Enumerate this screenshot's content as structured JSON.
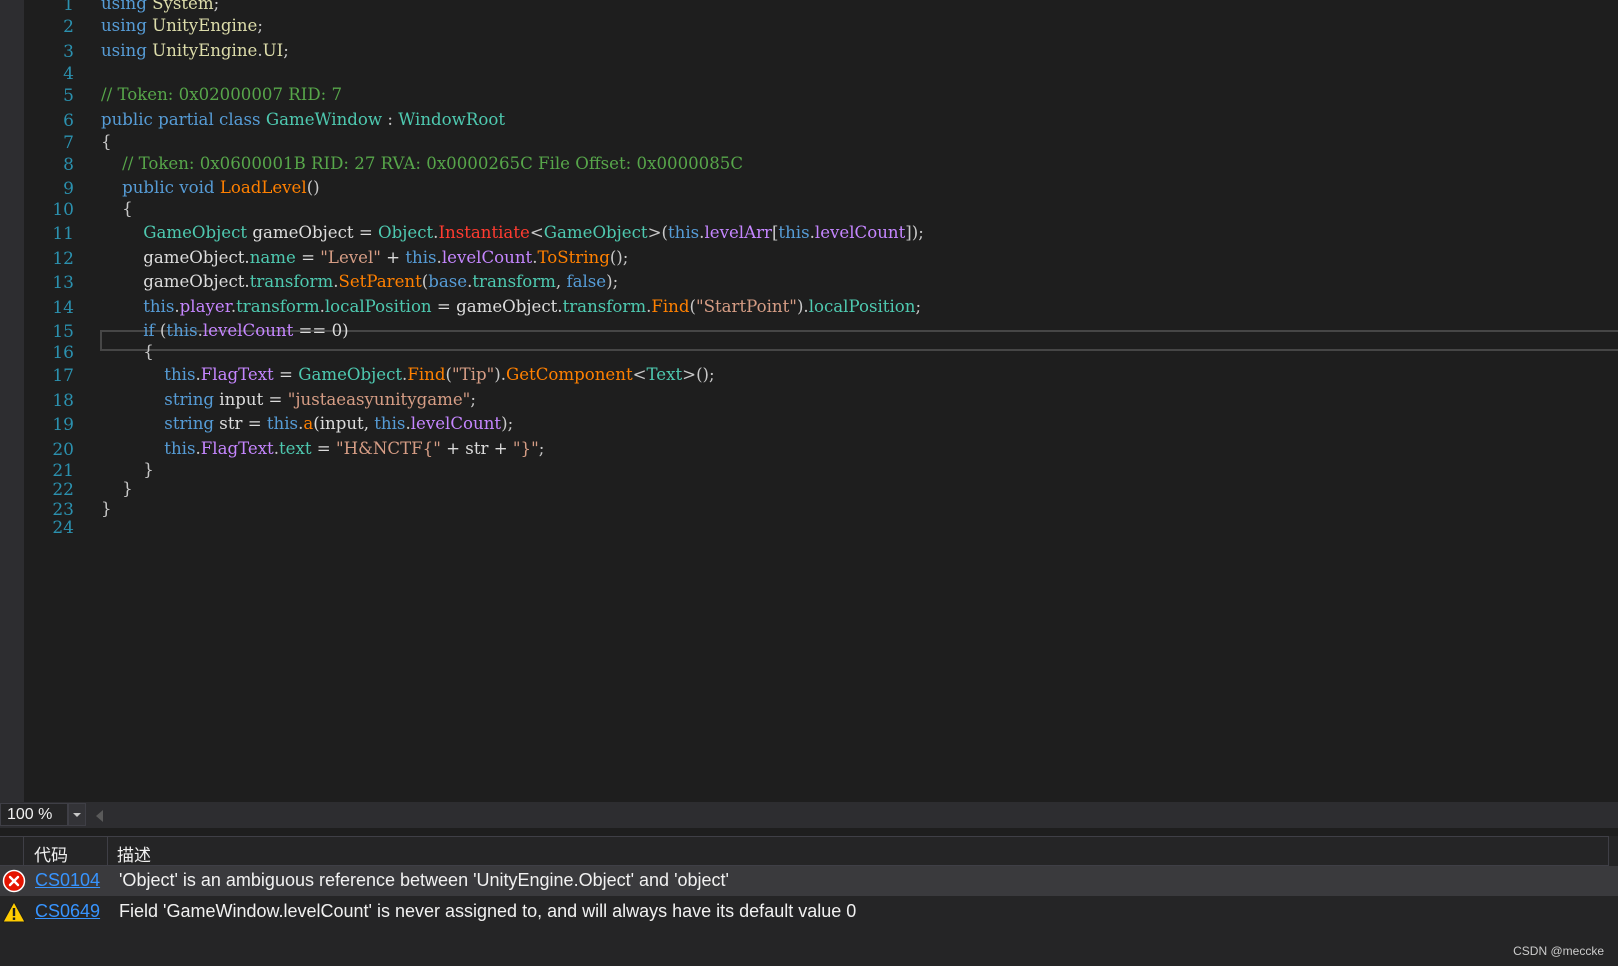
{
  "editor": {
    "line_numbers": [
      "1",
      "2",
      "3",
      "4",
      "5",
      "6",
      "7",
      "8",
      "9",
      "10",
      "11",
      "12",
      "13",
      "14",
      "15",
      "16",
      "17",
      "18",
      "19",
      "20",
      "21",
      "22",
      "23",
      "24"
    ],
    "colors": {
      "keyword": "#569cd6",
      "type": "#4ec9b0",
      "comment": "#57a64a",
      "string": "#d69d85",
      "method": "#ff8000",
      "error_token": "#ff3b30",
      "field": "#c586ff",
      "line_number": "#2b91af"
    },
    "lines": [
      {
        "tokens": [
          [
            "using",
            "k"
          ],
          [
            " ",
            "pl"
          ],
          [
            "System",
            "y"
          ],
          [
            ";",
            "p"
          ]
        ]
      },
      {
        "tokens": [
          [
            "using",
            "k"
          ],
          [
            " ",
            "pl"
          ],
          [
            "UnityEngine",
            "y"
          ],
          [
            ";",
            "p"
          ]
        ]
      },
      {
        "tokens": [
          [
            "using",
            "k"
          ],
          [
            " ",
            "pl"
          ],
          [
            "UnityEngine",
            "y"
          ],
          [
            ".",
            "p"
          ],
          [
            "UI",
            "y"
          ],
          [
            ";",
            "p"
          ]
        ]
      },
      {
        "tokens": []
      },
      {
        "tokens": [
          [
            "// Token: 0x02000007 RID: 7",
            "c"
          ]
        ]
      },
      {
        "tokens": [
          [
            "public",
            "k"
          ],
          [
            " ",
            "pl"
          ],
          [
            "partial",
            "k"
          ],
          [
            " ",
            "pl"
          ],
          [
            "class",
            "k"
          ],
          [
            " ",
            "pl"
          ],
          [
            "GameWindow",
            "t"
          ],
          [
            " : ",
            "p"
          ],
          [
            "WindowRoot",
            "t"
          ]
        ]
      },
      {
        "tokens": [
          [
            "{",
            "p"
          ]
        ]
      },
      {
        "tokens": [
          [
            "    ",
            "pl"
          ],
          [
            "// Token: 0x0600001B RID: 27 RVA: 0x0000265C File Offset: 0x0000085C",
            "c"
          ]
        ]
      },
      {
        "tokens": [
          [
            "    ",
            "pl"
          ],
          [
            "public",
            "k"
          ],
          [
            " ",
            "pl"
          ],
          [
            "void",
            "k"
          ],
          [
            " ",
            "pl"
          ],
          [
            "LoadLevel",
            "m"
          ],
          [
            "()",
            "p"
          ]
        ]
      },
      {
        "tokens": [
          [
            "    {",
            "p"
          ]
        ]
      },
      {
        "tokens": [
          [
            "        ",
            "pl"
          ],
          [
            "GameObject",
            "t"
          ],
          [
            " gameObject = ",
            "pl"
          ],
          [
            "Object",
            "t"
          ],
          [
            ".",
            "p"
          ],
          [
            "Instantiate",
            "r"
          ],
          [
            "<",
            "p"
          ],
          [
            "GameObject",
            "t"
          ],
          [
            ">(",
            "p"
          ],
          [
            "this",
            "k"
          ],
          [
            ".",
            "p"
          ],
          [
            "levelArr",
            "f"
          ],
          [
            "[",
            "p"
          ],
          [
            "this",
            "k"
          ],
          [
            ".",
            "p"
          ],
          [
            "levelCount",
            "f"
          ],
          [
            "]);",
            "p"
          ]
        ]
      },
      {
        "tokens": [
          [
            "        gameObject.",
            "pl"
          ],
          [
            "name",
            "pr"
          ],
          [
            " = ",
            "pl"
          ],
          [
            "\"Level\"",
            "s"
          ],
          [
            " + ",
            "pl"
          ],
          [
            "this",
            "k"
          ],
          [
            ".",
            "p"
          ],
          [
            "levelCount",
            "f"
          ],
          [
            ".",
            "p"
          ],
          [
            "ToString",
            "m"
          ],
          [
            "();",
            "p"
          ]
        ]
      },
      {
        "tokens": [
          [
            "        gameObject.",
            "pl"
          ],
          [
            "transform",
            "pr"
          ],
          [
            ".",
            "p"
          ],
          [
            "SetParent",
            "m"
          ],
          [
            "(",
            "p"
          ],
          [
            "base",
            "k"
          ],
          [
            ".",
            "p"
          ],
          [
            "transform",
            "pr"
          ],
          [
            ", ",
            "p"
          ],
          [
            "false",
            "k"
          ],
          [
            ");",
            "p"
          ]
        ]
      },
      {
        "tokens": [
          [
            "        ",
            "pl"
          ],
          [
            "this",
            "k"
          ],
          [
            ".",
            "p"
          ],
          [
            "player",
            "f"
          ],
          [
            ".",
            "p"
          ],
          [
            "transform",
            "pr"
          ],
          [
            ".",
            "p"
          ],
          [
            "localPosition",
            "pr"
          ],
          [
            " = gameObject.",
            "pl"
          ],
          [
            "transform",
            "pr"
          ],
          [
            ".",
            "p"
          ],
          [
            "Find",
            "m"
          ],
          [
            "(",
            "p"
          ],
          [
            "\"StartPoint\"",
            "s"
          ],
          [
            ").",
            "p"
          ],
          [
            "localPosition",
            "pr"
          ],
          [
            ";",
            "p"
          ]
        ]
      },
      {
        "tokens": [
          [
            "        ",
            "pl"
          ],
          [
            "if",
            "k"
          ],
          [
            " (",
            "p"
          ],
          [
            "this",
            "k"
          ],
          [
            ".",
            "p"
          ],
          [
            "levelCount",
            "f"
          ],
          [
            " == 0)",
            "pl"
          ]
        ]
      },
      {
        "tokens": [
          [
            "        {",
            "p"
          ]
        ]
      },
      {
        "tokens": [
          [
            "            ",
            "pl"
          ],
          [
            "this",
            "k"
          ],
          [
            ".",
            "p"
          ],
          [
            "FlagText",
            "f"
          ],
          [
            " = ",
            "pl"
          ],
          [
            "GameObject",
            "t"
          ],
          [
            ".",
            "p"
          ],
          [
            "Find",
            "m"
          ],
          [
            "(",
            "p"
          ],
          [
            "\"Tip\"",
            "s"
          ],
          [
            ").",
            "p"
          ],
          [
            "GetComponent",
            "m"
          ],
          [
            "<",
            "p"
          ],
          [
            "Text",
            "t"
          ],
          [
            ">();",
            "p"
          ]
        ]
      },
      {
        "tokens": [
          [
            "            ",
            "pl"
          ],
          [
            "string",
            "k"
          ],
          [
            " input = ",
            "pl"
          ],
          [
            "\"justaeasyunitygame\"",
            "s"
          ],
          [
            ";",
            "p"
          ]
        ]
      },
      {
        "tokens": [
          [
            "            ",
            "pl"
          ],
          [
            "string",
            "k"
          ],
          [
            " str = ",
            "pl"
          ],
          [
            "this",
            "k"
          ],
          [
            ".",
            "p"
          ],
          [
            "a",
            "m"
          ],
          [
            "(input, ",
            "pl"
          ],
          [
            "this",
            "k"
          ],
          [
            ".",
            "p"
          ],
          [
            "levelCount",
            "f"
          ],
          [
            ");",
            "p"
          ]
        ]
      },
      {
        "tokens": [
          [
            "            ",
            "pl"
          ],
          [
            "this",
            "k"
          ],
          [
            ".",
            "p"
          ],
          [
            "FlagText",
            "f"
          ],
          [
            ".",
            "p"
          ],
          [
            "text",
            "pr"
          ],
          [
            " = ",
            "pl"
          ],
          [
            "\"H&NCTF{\"",
            "s"
          ],
          [
            " + str + ",
            "pl"
          ],
          [
            "\"}\"",
            "s"
          ],
          [
            ";",
            "p"
          ]
        ]
      },
      {
        "tokens": [
          [
            "        }",
            "p"
          ]
        ]
      },
      {
        "tokens": [
          [
            "    }",
            "p"
          ]
        ]
      },
      {
        "tokens": [
          [
            "}",
            "p"
          ]
        ]
      },
      {
        "tokens": []
      }
    ]
  },
  "statusbar": {
    "zoom": "100 %"
  },
  "error_list": {
    "headers": {
      "code": "代码",
      "description": "描述"
    },
    "rows": [
      {
        "severity": "error-icon",
        "code": "CS0104",
        "description": "'Object' is an ambiguous reference between 'UnityEngine.Object' and 'object'"
      },
      {
        "severity": "warning-icon",
        "code": "CS0649",
        "description": "Field 'GameWindow.levelCount' is never assigned to, and will always have its default value 0"
      }
    ]
  },
  "watermark": "CSDN @meccke"
}
